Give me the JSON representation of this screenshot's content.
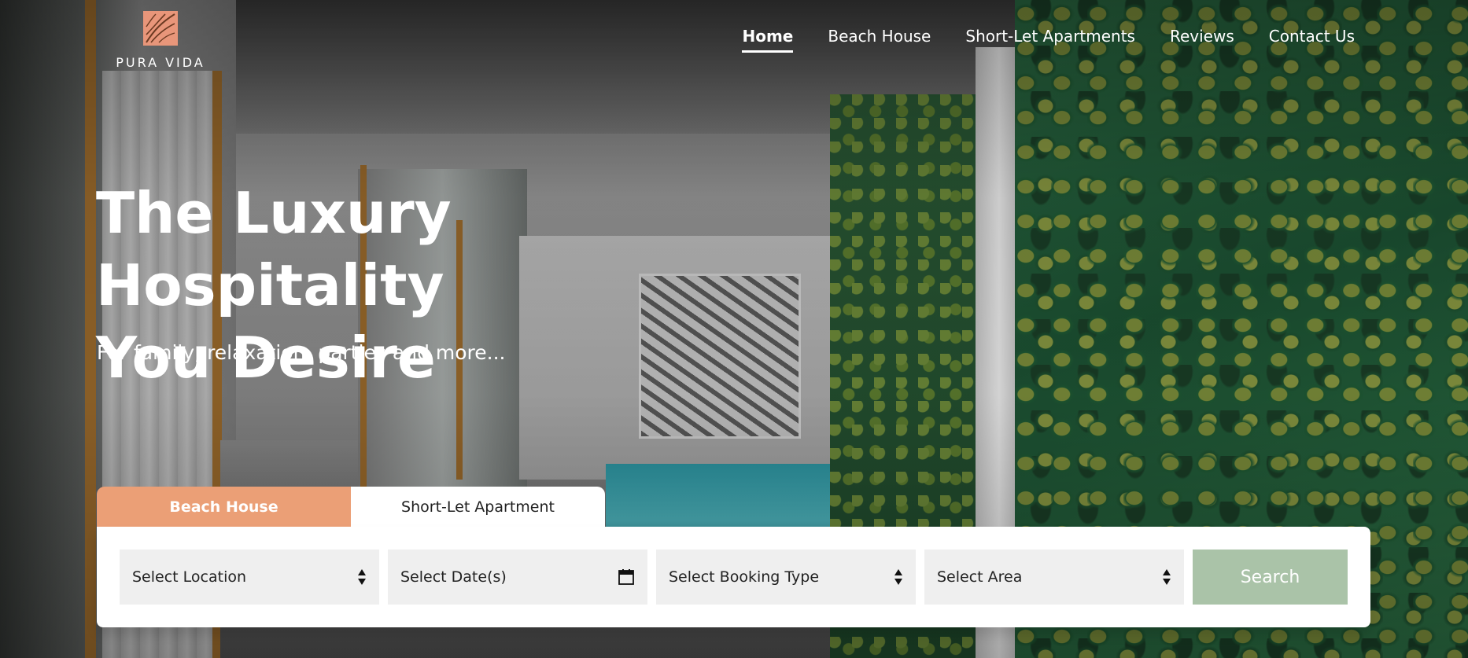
{
  "brand": {
    "name": "PURA VIDA",
    "logo_color": "#e8967a"
  },
  "nav": {
    "items": [
      {
        "label": "Home",
        "active": true
      },
      {
        "label": "Beach House",
        "active": false
      },
      {
        "label": "Short-Let Apartments",
        "active": false
      },
      {
        "label": "Reviews",
        "active": false
      },
      {
        "label": "Contact Us",
        "active": false
      }
    ]
  },
  "hero": {
    "title_line1": "The Luxury Hospitality",
    "title_line2": "You Desire",
    "subtitle": "For family, relaxation, parties and more..."
  },
  "booking": {
    "tabs": [
      {
        "label": "Beach House",
        "active": false
      },
      {
        "label": "Short-Let Apartment",
        "active": true
      }
    ],
    "fields": {
      "location": {
        "label": "Select Location",
        "icon": "sort-icon"
      },
      "dates": {
        "label": "Select Date(s)",
        "icon": "calendar-icon"
      },
      "booking_type": {
        "label": "Select Booking Type",
        "icon": "sort-icon"
      },
      "area": {
        "label": "Select Area",
        "icon": "sort-icon"
      }
    },
    "search_label": "Search"
  },
  "colors": {
    "accent_orange": "#eb9f76",
    "search_green": "#aac3a8",
    "field_bg": "#efefef"
  }
}
